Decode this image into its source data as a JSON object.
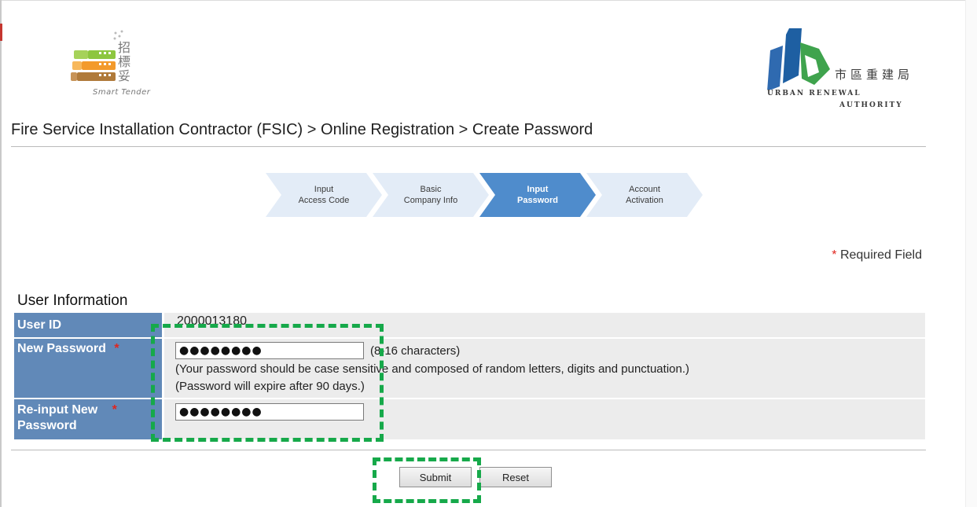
{
  "logos": {
    "smart_tender_chinese": "招\n標\n妥",
    "smart_tender_sub": "Smart Tender",
    "ura_chinese": "市區重建局",
    "ura_en_line1": "URBAN RENEWAL",
    "ura_en_line2": "AUTHORITY"
  },
  "breadcrumb": "Fire Service Installation Contractor (FSIC) > Online Registration > Create Password",
  "steps": [
    {
      "line1": "Input",
      "line2": "Access Code"
    },
    {
      "line1": "Basic",
      "line2": "Company Info"
    },
    {
      "line1": "Input",
      "line2": "Password"
    },
    {
      "line1": "Account",
      "line2": "Activation"
    }
  ],
  "active_step": "Input Password",
  "required_note": {
    "star": "*",
    "text": "Required Field"
  },
  "section_title": "User Information",
  "form": {
    "user_id_label": "User ID",
    "user_id_value": "2000013180",
    "new_password_label": "New Password",
    "new_password_value": "●●●●●●●●",
    "new_password_length_hint": "(8-16 characters)",
    "new_password_rule_hint": "(Your password should be case sensitive and composed of random letters, digits and punctuation.)",
    "new_password_expiry_hint": "(Password will expire after 90 days.)",
    "reinput_label_line1": "Re-input New",
    "reinput_label_line2": "Password",
    "reinput_value": "●●●●●●●●",
    "required_star": "*"
  },
  "buttons": {
    "submit": "Submit",
    "reset": "Reset"
  },
  "colors": {
    "label_bg": "#6189b8",
    "value_bg": "#ececec",
    "step_inactive": "#e3ecf7",
    "step_active": "#4f8ccc",
    "annotation": "#16a94a",
    "required": "#e0261f"
  }
}
